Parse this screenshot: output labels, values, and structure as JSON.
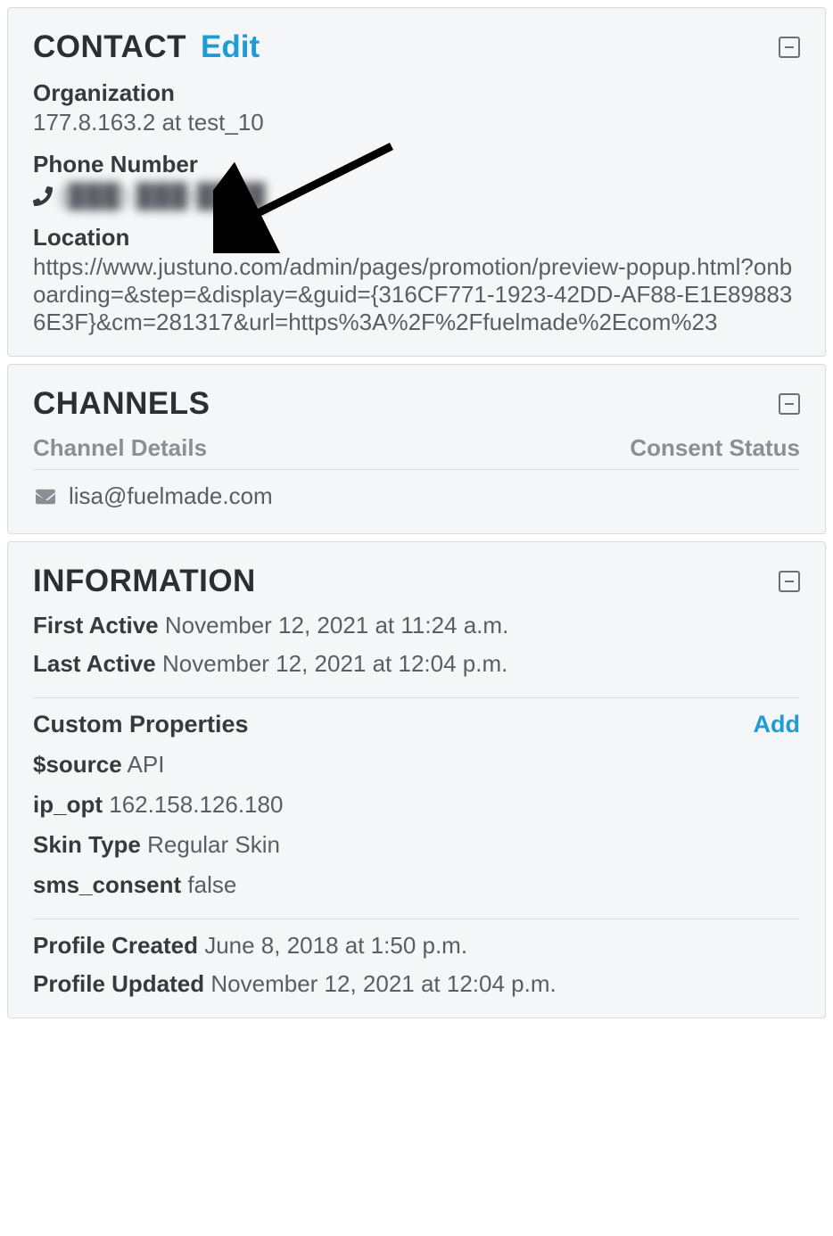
{
  "contact": {
    "panel_title": "CONTACT",
    "edit_label": "Edit",
    "org_label": "Organization",
    "org_value": "177.8.163.2 at test_10",
    "phone_label": "Phone Number",
    "phone_value": "(███) ███-████",
    "location_label": "Location",
    "location_value": "https://www.justuno.com/admin/pages/promotion/preview-popup.html?onboarding=&step=&display=&guid={316CF771-1923-42DD-AF88-E1E898836E3F}&cm=281317&url=https%3A%2F%2Ffuelmade%2Ecom%23"
  },
  "channels": {
    "panel_title": "CHANNELS",
    "col_details": "Channel Details",
    "col_consent": "Consent Status",
    "email": "lisa@fuelmade.com"
  },
  "info": {
    "panel_title": "INFORMATION",
    "first_active_label": "First Active",
    "first_active_value": "November 12, 2021 at 11:24 a.m.",
    "last_active_label": "Last Active",
    "last_active_value": "November 12, 2021 at 12:04 p.m.",
    "custom_props_title": "Custom Properties",
    "add_label": "Add",
    "props": [
      {
        "key": "$source",
        "val": "API"
      },
      {
        "key": "ip_opt",
        "val": "162.158.126.180"
      },
      {
        "key": "Skin Type",
        "val": "Regular Skin"
      },
      {
        "key": "sms_consent",
        "val": "false"
      }
    ],
    "profile_created_label": "Profile Created",
    "profile_created_value": "June 8, 2018 at 1:50 p.m.",
    "profile_updated_label": "Profile Updated",
    "profile_updated_value": "November 12, 2021 at 12:04 p.m."
  }
}
